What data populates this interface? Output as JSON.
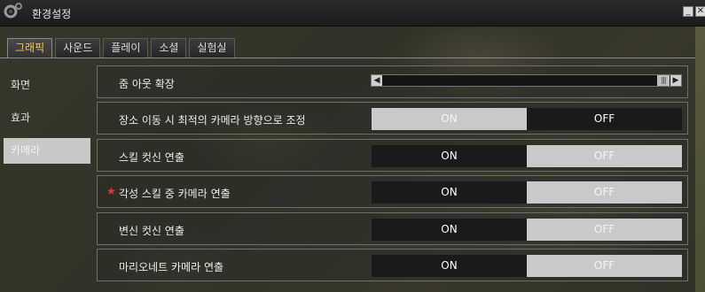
{
  "window": {
    "title": "환경설정",
    "min_label": "_",
    "close_label": "✕"
  },
  "tabs": [
    {
      "label": "그래픽",
      "active": true
    },
    {
      "label": "사운드",
      "active": false
    },
    {
      "label": "플레이",
      "active": false
    },
    {
      "label": "소셜",
      "active": false
    },
    {
      "label": "실험실",
      "active": false
    }
  ],
  "sidebar": {
    "items": [
      {
        "label": "화면",
        "selected": false
      },
      {
        "label": "효과",
        "selected": false
      },
      {
        "label": "카메라",
        "selected": true
      }
    ]
  },
  "settings": {
    "zoom": {
      "label": "줌 아웃 확장",
      "value_percent": 100
    },
    "rows": [
      {
        "label": "장소 이동 시 최적의 카메라 방향으로 조정",
        "on": "ON",
        "off": "OFF",
        "selected": "OFF",
        "starred": false
      },
      {
        "label": "스킬 컷신 연출",
        "on": "ON",
        "off": "OFF",
        "selected": "ON",
        "starred": false
      },
      {
        "label": "각성 스킬 중 카메라 연출",
        "on": "ON",
        "off": "OFF",
        "selected": "ON",
        "starred": true
      },
      {
        "label": "변신 컷신 연출",
        "on": "ON",
        "off": "OFF",
        "selected": "ON",
        "starred": false
      },
      {
        "label": "마리오네트 카메라 연출",
        "on": "ON",
        "off": "OFF",
        "selected": "ON",
        "starred": false
      }
    ],
    "star_glyph": "★"
  },
  "colors": {
    "active_tab": "#f2c94a",
    "star": "#e03a2a",
    "selected_toggle": "#1a1a1a",
    "unselected_toggle": "#c9c9c9"
  }
}
